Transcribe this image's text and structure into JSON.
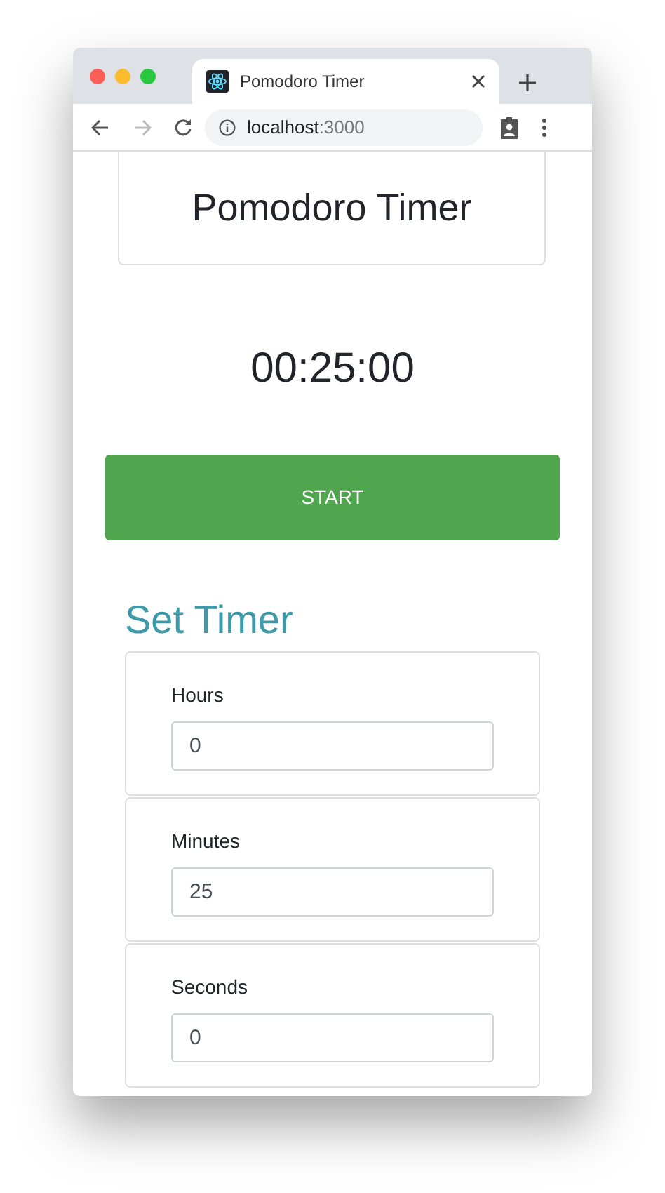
{
  "browser": {
    "tab_title": "Pomodoro Timer",
    "url_host": "localhost",
    "url_port": ":3000"
  },
  "header": {
    "title": "Pomodoro Timer"
  },
  "timer": {
    "display": "00:25:00"
  },
  "start_button": {
    "label": "START"
  },
  "set_timer": {
    "heading": "Set Timer",
    "fields": [
      {
        "label": "Hours",
        "value": "0"
      },
      {
        "label": "Minutes",
        "value": "25"
      },
      {
        "label": "Seconds",
        "value": "0"
      }
    ]
  }
}
